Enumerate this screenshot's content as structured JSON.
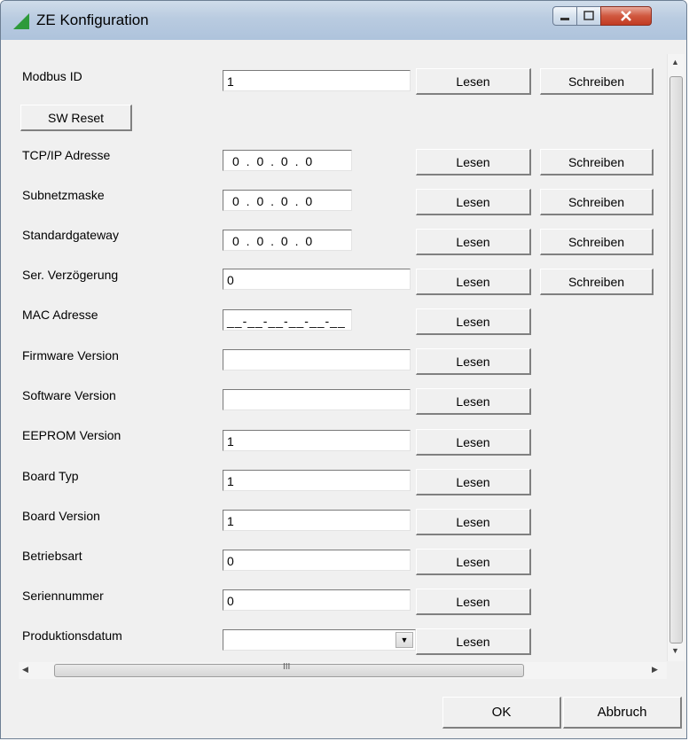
{
  "window": {
    "title": "ZE Konfiguration"
  },
  "rows": [
    {
      "label": "Modbus ID",
      "value": "1",
      "read": "Lesen",
      "write": "Schreiben"
    },
    {
      "label": "TCP/IP Adresse",
      "value": "0 . 0 . 0 . 0",
      "read": "Lesen",
      "write": "Schreiben"
    },
    {
      "label": "Subnetzmaske",
      "value": "0 . 0 . 0 . 0",
      "read": "Lesen",
      "write": "Schreiben"
    },
    {
      "label": "Standardgateway",
      "value": "0 . 0 . 0 . 0",
      "read": "Lesen",
      "write": "Schreiben"
    },
    {
      "label": "Ser. Verzögerung",
      "value": "0",
      "read": "Lesen",
      "write": "Schreiben"
    },
    {
      "label": "MAC Adresse",
      "value": "__-__-__-__-__-__",
      "read": "Lesen"
    },
    {
      "label": "Firmware Version",
      "value": "",
      "read": "Lesen"
    },
    {
      "label": "Software Version",
      "value": "",
      "read": "Lesen"
    },
    {
      "label": "EEPROM Version",
      "value": "1",
      "read": "Lesen"
    },
    {
      "label": "Board Typ",
      "value": "1",
      "read": "Lesen"
    },
    {
      "label": "Board Version",
      "value": "1",
      "read": "Lesen"
    },
    {
      "label": "Betriebsart",
      "value": "0",
      "read": "Lesen"
    },
    {
      "label": "Seriennummer",
      "value": "0",
      "read": "Lesen"
    },
    {
      "label": "Produktionsdatum",
      "value": "",
      "read": "Lesen"
    }
  ],
  "sw_reset_label": "SW Reset",
  "footer": {
    "ok": "OK",
    "cancel": "Abbruch"
  },
  "scrollbar": {
    "grip": "III"
  }
}
